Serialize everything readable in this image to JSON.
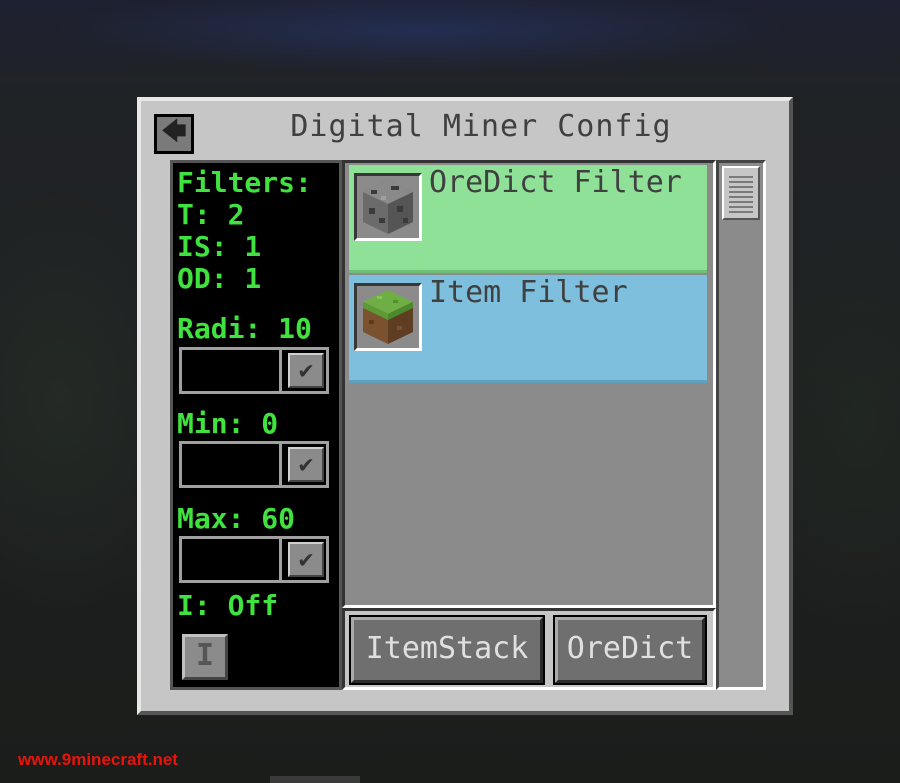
{
  "window": {
    "title": "Digital Miner Config",
    "back_icon": "arrow-left-icon",
    "back_glyph": "🡄"
  },
  "stats": {
    "filters_label": "Filters:",
    "t": "T: 2",
    "is": "IS: 1",
    "od": "OD: 1",
    "radius": "Radi: 10",
    "min": "Min: 0",
    "max": "Max: 60",
    "inverse": "I: Off"
  },
  "fields": {
    "radius_value": "",
    "min_value": "",
    "max_value": "",
    "check_glyph": "✔"
  },
  "toggle_glyph": "I",
  "filters": [
    {
      "label": "OreDict Filter",
      "icon": "cobblestone-ore-block-icon",
      "color": "#8fe198"
    },
    {
      "label": "Item Filter",
      "icon": "grass-block-icon",
      "color": "#7dbfdc"
    }
  ],
  "buttons": {
    "itemstack": "ItemStack",
    "oredict": "OreDict"
  },
  "watermark": "www.9minecraft.net"
}
